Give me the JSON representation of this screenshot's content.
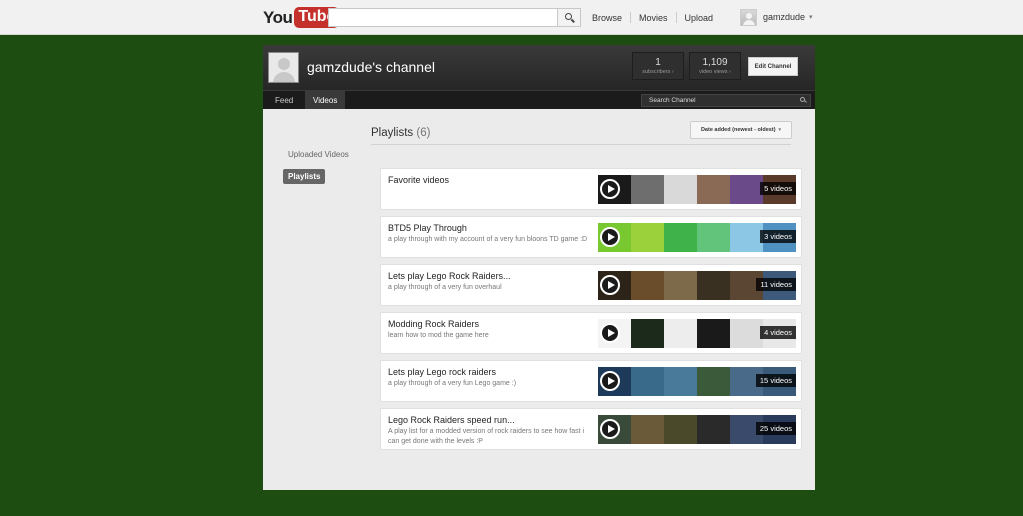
{
  "masthead": {
    "logo_you": "You",
    "logo_tube": "Tube",
    "search_value": "",
    "nav": [
      "Browse",
      "Movies",
      "Upload"
    ],
    "username": "gamzdude"
  },
  "channel": {
    "title": "gamzdude's channel",
    "subscribers": {
      "value": "1",
      "label": "subscribers ›"
    },
    "views": {
      "value": "1,109",
      "label": "video views ›"
    },
    "edit_label": "Edit Channel",
    "tabs": [
      "Feed",
      "Videos"
    ],
    "active_tab": "Videos",
    "search_placeholder": "Search Channel"
  },
  "sidebar": {
    "uploaded": "Uploaded Videos",
    "playlists": "Playlists"
  },
  "playlists_section": {
    "heading": "Playlists",
    "count": "(6)",
    "sort_label": "Date added (newest - oldest)"
  },
  "playlists": [
    {
      "title": "Favorite videos",
      "desc": "",
      "count": "5 videos",
      "colors": [
        "#1a1a1a",
        "#6e6e6e",
        "#d9d9d9",
        "#8a6a55",
        "#6b4a8a",
        "#5a3a2a"
      ]
    },
    {
      "title": "BTD5 Play Through",
      "desc": "a play through with my account of a very fun bloons TD game :D",
      "count": "3 videos",
      "colors": [
        "#78c830",
        "#9bd13a",
        "#3fb34a",
        "#62c47a",
        "#8cc7e6",
        "#4f92c2"
      ]
    },
    {
      "title": "Lets play Lego Rock Raiders...",
      "desc": "a play through of a very fun overhaul",
      "count": "11 videos",
      "colors": [
        "#2c2418",
        "#6a4e2c",
        "#7d6a4a",
        "#3a3022",
        "#5a4632",
        "#3e5a7a"
      ]
    },
    {
      "title": "Modding Rock Raiders",
      "desc": "learn how to mod the game here",
      "count": "4 videos",
      "colors": [
        "#f4f4f4",
        "#1c2a1c",
        "#ededed",
        "#1a1a1a",
        "#dcdcdc",
        "#e8e8e8"
      ]
    },
    {
      "title": "Lets play Lego rock raiders",
      "desc": "a play through of a very fun Lego game :)",
      "count": "15 videos",
      "colors": [
        "#1e3a5a",
        "#3a6a8a",
        "#4a7a9a",
        "#3a5a3a",
        "#4a6a8a",
        "#3a5a7a"
      ]
    },
    {
      "title": "Lego Rock Raiders speed run...",
      "desc": "A play list for a modded version of rock raiders to see how fast i can get done with the levels :P",
      "count": "25 videos",
      "colors": [
        "#3a4a3a",
        "#6a5a3a",
        "#4a4a2a",
        "#2a2a2a",
        "#3a4a6a",
        "#2a3a5a"
      ]
    }
  ]
}
